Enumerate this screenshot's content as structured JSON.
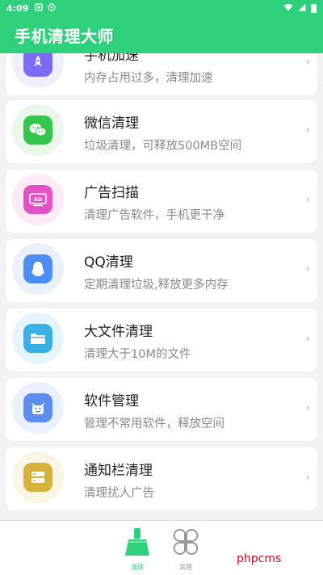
{
  "status_bar": {
    "time": "4:09"
  },
  "app_bar": {
    "title": "手机清理大师"
  },
  "items": [
    {
      "title": "手机加速",
      "subtitle": "内存占用过多，清理加速",
      "icon": "rocket-icon",
      "color": "#7b6cf6",
      "bg": "#eef0fc"
    },
    {
      "title": "微信清理",
      "subtitle": "垃圾清理，可释放500MB空间",
      "icon": "wechat-icon",
      "color": "#33c64a",
      "bg": "#eaf8ec"
    },
    {
      "title": "广告扫描",
      "subtitle": "清理广告软件，手机更干净",
      "icon": "ad-icon",
      "color": "#e552c8",
      "bg": "#fcebf7"
    },
    {
      "title": "QQ清理",
      "subtitle": "定期清理垃圾,释放更多内存",
      "icon": "qq-penguin-icon",
      "color": "#4c8df6",
      "bg": "#eaf1fd"
    },
    {
      "title": "大文件清理",
      "subtitle": "清理大于10M的文件",
      "icon": "folder-icon",
      "color": "#3ab0e4",
      "bg": "#e6f5fb"
    },
    {
      "title": "软件管理",
      "subtitle": "管理不常用软件，释放空间",
      "icon": "android-robot-icon",
      "color": "#5b8ef0",
      "bg": "#eaf0fd"
    },
    {
      "title": "通知栏清理",
      "subtitle": "清理扰人广告",
      "icon": "notification-list-icon",
      "color": "#d8b13a",
      "bg": "#fbf6e4"
    }
  ],
  "bottom_nav": {
    "tabs": [
      {
        "label": "清理",
        "icon": "broom-icon",
        "active": true,
        "color": "#2fd07c"
      },
      {
        "label": "常用",
        "icon": "four-leaf-grid-icon",
        "active": false,
        "color": "#999999"
      }
    ]
  },
  "watermark": "phpcms"
}
